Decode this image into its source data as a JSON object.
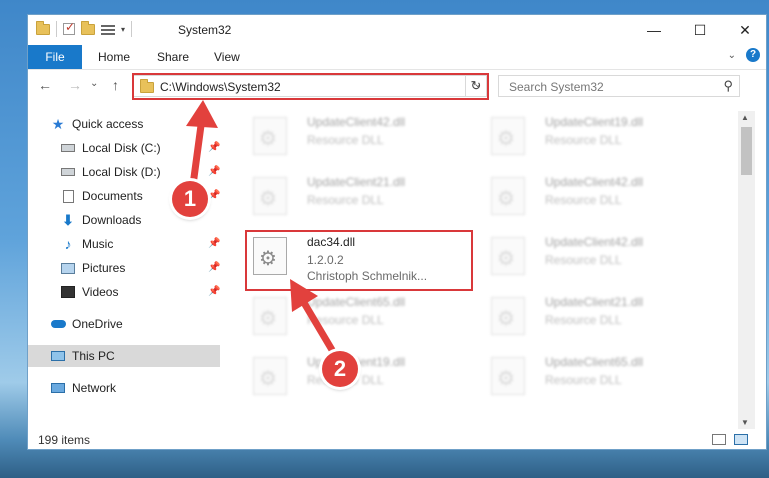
{
  "window": {
    "title": "System32"
  },
  "window_buttons": {
    "minimize": "—",
    "maximize": "☐",
    "close": "✕"
  },
  "menu": {
    "file": "File",
    "home": "Home",
    "share": "Share",
    "view": "View"
  },
  "nav": {
    "back": "←",
    "forward": "→",
    "recent": "⌄",
    "up": "↑"
  },
  "address": {
    "path": "C:\\Windows\\System32",
    "refresh": "↻",
    "dropdown": "⌄"
  },
  "search": {
    "placeholder": "Search System32"
  },
  "sidebar": {
    "items": [
      {
        "label": "Quick access"
      },
      {
        "label": "Local Disk (C:)"
      },
      {
        "label": "Local Disk (D:)"
      },
      {
        "label": "Documents"
      },
      {
        "label": "Downloads"
      },
      {
        "label": "Music"
      },
      {
        "label": "Pictures"
      },
      {
        "label": "Videos"
      },
      {
        "label": "OneDrive"
      },
      {
        "label": "This PC"
      },
      {
        "label": "Network"
      }
    ]
  },
  "files": [
    {
      "name": "UpdateClient42.dll",
      "type": "Resource DLL"
    },
    {
      "name": "UpdateClient19.dll",
      "type": "Resource DLL"
    },
    {
      "name": "UpdateClient21.dll",
      "type": "Resource DLL"
    },
    {
      "name": "UpdateClient42.dll",
      "type": "Resource DLL"
    },
    {
      "name": "dac34.dll",
      "version": "1.2.0.2",
      "company": "Christoph Schmelnik..."
    },
    {
      "name": "UpdateClient42.dll",
      "type": "Resource DLL"
    },
    {
      "name": "UpdateClient65.dll",
      "type": "Resource DLL"
    },
    {
      "name": "UpdateClient21.dll",
      "type": "Resource DLL"
    },
    {
      "name": "UpdateClient19.dll",
      "type": "Resource DLL"
    },
    {
      "name": "UpdateClient65.dll",
      "type": "Resource DLL"
    }
  ],
  "status": {
    "items": "199 items"
  },
  "badges": {
    "one": "1",
    "two": "2"
  },
  "colors": {
    "accent": "#1979ca",
    "highlight": "#d9383a"
  }
}
